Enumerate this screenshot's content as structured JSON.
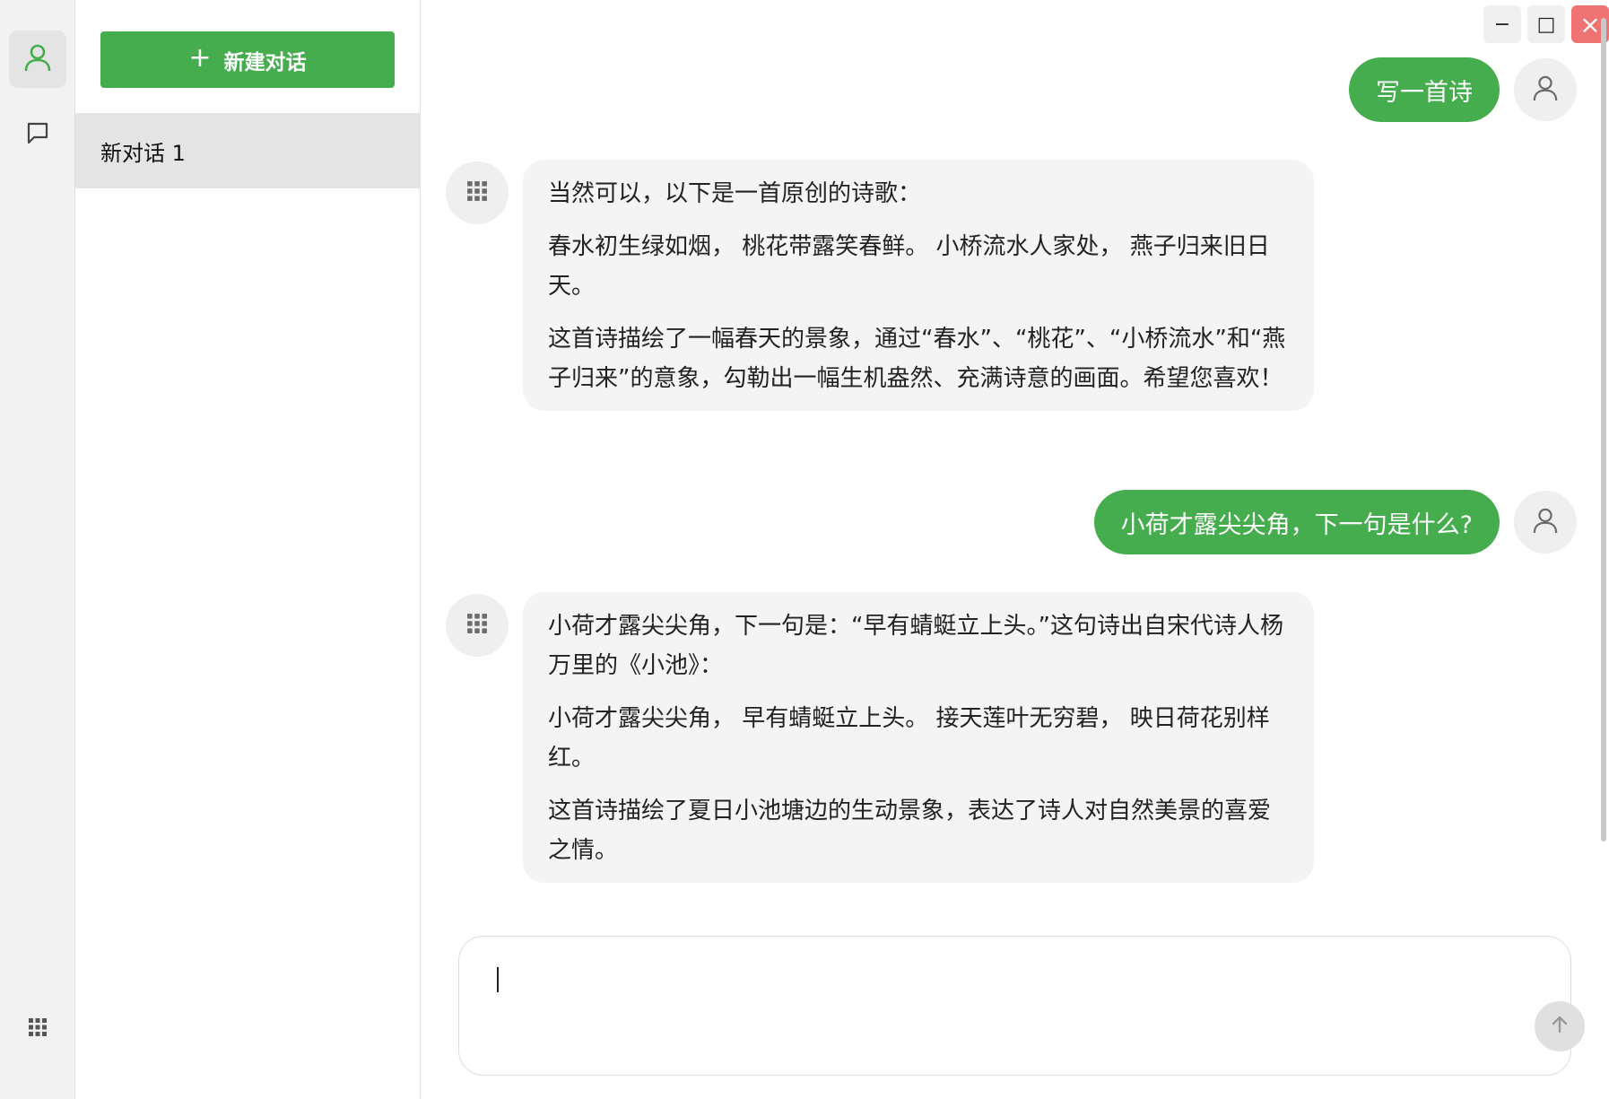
{
  "rail": {
    "items": [
      "user-icon",
      "chat-icon"
    ],
    "bottom": "apps-grid-icon",
    "accent": "#45ad4d"
  },
  "sidebar": {
    "new_chat_label": "新建对话",
    "conversations": [
      {
        "title": "新对话 1",
        "selected": true
      }
    ]
  },
  "window": {
    "minimize_glyph": "−",
    "maximize_glyph": "□",
    "close_glyph": "×"
  },
  "chat": {
    "messages": [
      {
        "role": "user",
        "text": "写一首诗"
      },
      {
        "role": "assistant",
        "paragraphs": [
          "当然可以，以下是一首原创的诗歌：",
          "春水初生绿如烟， 桃花带露笑春鲜。 小桥流水人家处， 燕子归来旧日天。",
          "这首诗描绘了一幅春天的景象，通过“春水”、“桃花”、“小桥流水”和“燕子归来”的意象，勾勒出一幅生机盎然、充满诗意的画面。希望您喜欢！"
        ]
      },
      {
        "role": "user",
        "text": "小荷才露尖尖角，下一句是什么?"
      },
      {
        "role": "assistant",
        "paragraphs": [
          "小荷才露尖尖角，下一句是：“早有蜻蜓立上头。”这句诗出自宋代诗人杨万里的《小池》：",
          "小荷才露尖尖角， 早有蜻蜓立上头。 接天莲叶无穷碧， 映日荷花别样红。",
          "这首诗描绘了夏日小池塘边的生动景象，表达了诗人对自然美景的喜爱之情。"
        ]
      }
    ]
  },
  "input": {
    "value": "",
    "placeholder": ""
  }
}
